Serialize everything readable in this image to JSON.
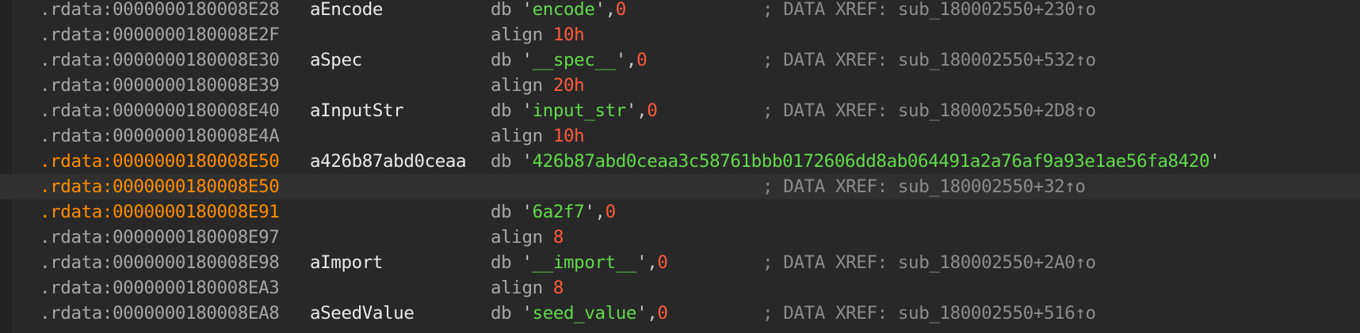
{
  "colors": {
    "background": "#282828",
    "address": "#a6a6a6",
    "address_highlight": "#ff8c00",
    "label": "#eaeaea",
    "mnemonic": "#a8a8a8",
    "number": "#ff5a3d",
    "string": "#62d94c",
    "comment": "#8c8c8c"
  },
  "rows": [
    {
      "addr": ".rdata:0000000180008E28",
      "label": "aEncode",
      "kw": "db",
      "pre": " '",
      "val": "encode",
      "post": "',",
      "num": "0",
      "comment": "; DATA XREF: sub_180002550+230↑o"
    },
    {
      "addr": ".rdata:0000000180008E2F",
      "label": "",
      "kw": "align",
      "pre": " ",
      "val": "",
      "post": "",
      "num": "10h",
      "comment": ""
    },
    {
      "addr": ".rdata:0000000180008E30",
      "label": "aSpec",
      "kw": "db",
      "pre": " '",
      "val": "__spec__",
      "post": "',",
      "num": "0",
      "comment": "; DATA XREF: sub_180002550+532↑o"
    },
    {
      "addr": ".rdata:0000000180008E39",
      "label": "",
      "kw": "align",
      "pre": " ",
      "val": "",
      "post": "",
      "num": "20h",
      "comment": ""
    },
    {
      "addr": ".rdata:0000000180008E40",
      "label": "aInputStr",
      "kw": "db",
      "pre": " '",
      "val": "input_str",
      "post": "',",
      "num": "0",
      "comment": "; DATA XREF: sub_180002550+2D8↑o"
    },
    {
      "addr": ".rdata:0000000180008E4A",
      "label": "",
      "kw": "align",
      "pre": " ",
      "val": "",
      "post": "",
      "num": "10h",
      "comment": ""
    },
    {
      "addr": ".rdata:0000000180008E50",
      "label": "a426b87abd0ceaa",
      "kw": "db",
      "pre": " '",
      "val": "426b87abd0ceaa3c58761bbb0172606dd8ab064491a2a76af9a93e1ae56fa8420",
      "post": "'",
      "num": "",
      "comment": ""
    },
    {
      "addr": ".rdata:0000000180008E50",
      "label": "",
      "kw": "",
      "pre": "",
      "val": "",
      "post": "",
      "num": "",
      "comment": "; DATA XREF: sub_180002550+32↑o"
    },
    {
      "addr": ".rdata:0000000180008E91",
      "label": "",
      "kw": "db",
      "pre": " '",
      "val": "6a2f7",
      "post": "',",
      "num": "0",
      "comment": ""
    },
    {
      "addr": ".rdata:0000000180008E97",
      "label": "",
      "kw": "align",
      "pre": " ",
      "val": "",
      "post": "",
      "num": "8",
      "comment": ""
    },
    {
      "addr": ".rdata:0000000180008E98",
      "label": "aImport",
      "kw": "db",
      "pre": " '",
      "val": "__import__",
      "post": "',",
      "num": "0",
      "comment": "; DATA XREF: sub_180002550+2A0↑o"
    },
    {
      "addr": ".rdata:0000000180008EA3",
      "label": "",
      "kw": "align",
      "pre": " ",
      "val": "",
      "post": "",
      "num": "8",
      "comment": ""
    },
    {
      "addr": ".rdata:0000000180008EA8",
      "label": "aSeedValue",
      "kw": "db",
      "pre": " '",
      "val": "seed_value",
      "post": "',",
      "num": "0",
      "comment": "; DATA XREF: sub_180002550+516↑o"
    }
  ]
}
